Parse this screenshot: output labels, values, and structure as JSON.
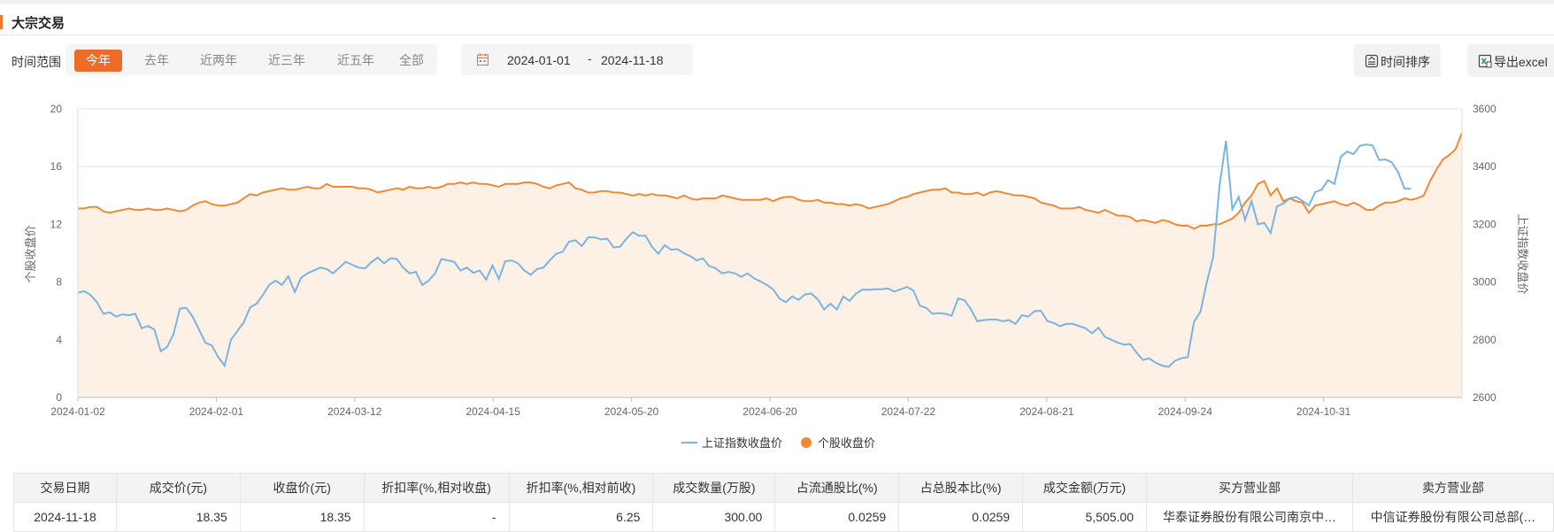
{
  "section": {
    "title": "大宗交易"
  },
  "filters": {
    "range_label": "时间范围",
    "ranges": [
      "今年",
      "去年",
      "近两年",
      "近三年",
      "近五年",
      "全部"
    ],
    "active_range": "今年",
    "date_start": "2024-01-01",
    "date_sep": "-",
    "date_end": "2024-11-18"
  },
  "toolbar": {
    "sort_label": "时间排序",
    "export_label": "导出excel"
  },
  "colors": {
    "accent": "#ee6c2a",
    "index_line": "#7bb3e2",
    "stock_line": "#ee8a34",
    "stock_fill": "#fdeee2"
  },
  "chart_data": {
    "type": "line",
    "x_ticks": [
      "2024-01-02",
      "2024-02-01",
      "2024-03-12",
      "2024-04-15",
      "2024-05-20",
      "2024-06-20",
      "2024-07-22",
      "2024-08-21",
      "2024-09-24",
      "2024-10-31"
    ],
    "ylabel_left": "个股收盘价",
    "ylabel_right": "上证指数收盘价",
    "ylim_left": [
      0,
      20
    ],
    "ylim_right": [
      2600,
      3600
    ],
    "yticks_left": [
      "0",
      "4",
      "8",
      "12",
      "16",
      "20"
    ],
    "yticks_right": [
      "2600",
      "2800",
      "3000",
      "3200",
      "3400",
      "3600"
    ],
    "grid": true,
    "legend_position": "bottom",
    "series": [
      {
        "name": "上证指数收盘价",
        "axis": "right",
        "values": [
          2963,
          2968,
          2955,
          2930,
          2890,
          2895,
          2880,
          2888,
          2885,
          2890,
          2840,
          2848,
          2835,
          2760,
          2775,
          2820,
          2908,
          2910,
          2880,
          2835,
          2790,
          2780,
          2740,
          2710,
          2800,
          2830,
          2860,
          2912,
          2925,
          2955,
          2990,
          3005,
          2990,
          3020,
          2965,
          3015,
          3030,
          3040,
          3050,
          3045,
          3030,
          3050,
          3070,
          3060,
          3050,
          3047,
          3068,
          3085,
          3065,
          3082,
          3080,
          3050,
          3030,
          3035,
          2990,
          3005,
          3030,
          3080,
          3075,
          3070,
          3040,
          3050,
          3032,
          3040,
          3008,
          3057,
          3010,
          3072,
          3075,
          3065,
          3040,
          3025,
          3045,
          3050,
          3075,
          3098,
          3105,
          3140,
          3145,
          3125,
          3155,
          3155,
          3148,
          3150,
          3120,
          3122,
          3150,
          3173,
          3160,
          3160,
          3122,
          3098,
          3128,
          3112,
          3114,
          3100,
          3090,
          3075,
          3082,
          3055,
          3048,
          3030,
          3035,
          3030,
          3018,
          3030,
          3013,
          3002,
          2990,
          2975,
          2943,
          2930,
          2950,
          2938,
          2957,
          2960,
          2940,
          2905,
          2925,
          2905,
          2950,
          2935,
          2960,
          2974,
          2973,
          2975,
          2975,
          2978,
          2967,
          2975,
          2983,
          2970,
          2918,
          2910,
          2890,
          2892,
          2890,
          2883,
          2943,
          2937,
          2906,
          2864,
          2868,
          2870,
          2870,
          2864,
          2868,
          2855,
          2885,
          2880,
          2899,
          2900,
          2865,
          2858,
          2847,
          2855,
          2855,
          2847,
          2840,
          2822,
          2842,
          2810,
          2800,
          2790,
          2783,
          2785,
          2755,
          2730,
          2735,
          2720,
          2710,
          2706,
          2727,
          2736,
          2740,
          2863,
          2897,
          3000,
          3087,
          3336,
          3489,
          3252,
          3295,
          3215,
          3280,
          3200,
          3205,
          3170,
          3262,
          3272,
          3290,
          3295,
          3281,
          3265,
          3312,
          3320,
          3353,
          3340,
          3434,
          3452,
          3443,
          3472,
          3477,
          3473,
          3423,
          3425,
          3415,
          3380,
          3324,
          3323
        ]
      },
      {
        "name": "个股收盘价",
        "axis": "left",
        "values": [
          13.1,
          13.1,
          13.2,
          13.2,
          12.9,
          12.8,
          12.9,
          13.0,
          13.1,
          13.0,
          13.0,
          13.1,
          13.0,
          13.0,
          13.1,
          13.0,
          12.9,
          13.0,
          13.3,
          13.5,
          13.6,
          13.4,
          13.3,
          13.3,
          13.4,
          13.5,
          13.8,
          14.1,
          14.0,
          14.2,
          14.3,
          14.4,
          14.5,
          14.4,
          14.4,
          14.5,
          14.6,
          14.5,
          14.5,
          14.8,
          14.6,
          14.6,
          14.6,
          14.6,
          14.5,
          14.5,
          14.4,
          14.2,
          14.3,
          14.4,
          14.5,
          14.4,
          14.6,
          14.5,
          14.5,
          14.6,
          14.5,
          14.6,
          14.8,
          14.8,
          14.9,
          14.8,
          14.9,
          14.8,
          14.8,
          14.7,
          14.6,
          14.8,
          14.8,
          14.8,
          14.9,
          14.9,
          14.8,
          14.6,
          14.5,
          14.7,
          14.8,
          14.9,
          14.5,
          14.4,
          14.2,
          14.2,
          14.3,
          14.3,
          14.2,
          14.2,
          14.1,
          14.0,
          14.1,
          14.0,
          14.1,
          14.0,
          14.0,
          13.9,
          13.8,
          14.0,
          13.8,
          13.7,
          13.8,
          13.8,
          13.8,
          14.0,
          13.9,
          13.8,
          13.7,
          13.7,
          13.7,
          13.7,
          13.8,
          13.6,
          13.8,
          13.9,
          13.9,
          13.7,
          13.6,
          13.6,
          13.7,
          13.5,
          13.5,
          13.4,
          13.4,
          13.3,
          13.4,
          13.3,
          13.1,
          13.2,
          13.3,
          13.4,
          13.6,
          13.8,
          13.9,
          14.1,
          14.2,
          14.3,
          14.4,
          14.4,
          14.5,
          14.2,
          14.2,
          14.1,
          14.1,
          14.2,
          14.0,
          14.2,
          14.3,
          14.2,
          14.1,
          14.0,
          14.0,
          13.9,
          13.8,
          13.5,
          13.4,
          13.3,
          13.1,
          13.1,
          13.1,
          13.2,
          13.0,
          12.9,
          12.8,
          13.0,
          12.8,
          12.6,
          12.6,
          12.5,
          12.2,
          12.3,
          12.2,
          12.1,
          12.3,
          12.2,
          12.0,
          11.9,
          11.9,
          11.7,
          11.9,
          11.9,
          12.0,
          12.0,
          12.2,
          12.4,
          12.8,
          13.5,
          14.0,
          14.8,
          15.0,
          14.0,
          14.5,
          13.6,
          13.8,
          13.6,
          13.5,
          12.8,
          13.3,
          13.4,
          13.5,
          13.6,
          13.4,
          13.3,
          13.5,
          13.3,
          13.0,
          13.0,
          13.3,
          13.5,
          13.5,
          13.6,
          13.8,
          13.7,
          13.8,
          14.0,
          15.0,
          15.8,
          16.5,
          16.8,
          17.2,
          18.35
        ]
      }
    ]
  },
  "table": {
    "headers": [
      "交易日期",
      "成交价(元)",
      "收盘价(元)",
      "折扣率(%,相对收盘)",
      "折扣率(%,相对前收)",
      "成交数量(万股)",
      "占流通股比(%)",
      "占总股本比(%)",
      "成交金额(万元)",
      "买方营业部",
      "卖方营业部"
    ],
    "rows": [
      [
        "2024-11-18",
        "18.35",
        "18.35",
        "-",
        "6.25",
        "300.00",
        "0.0259",
        "0.0259",
        "5,505.00",
        "华泰证券股份有限公司南京中…",
        "中信证券股份有限公司总部(…"
      ]
    ]
  }
}
